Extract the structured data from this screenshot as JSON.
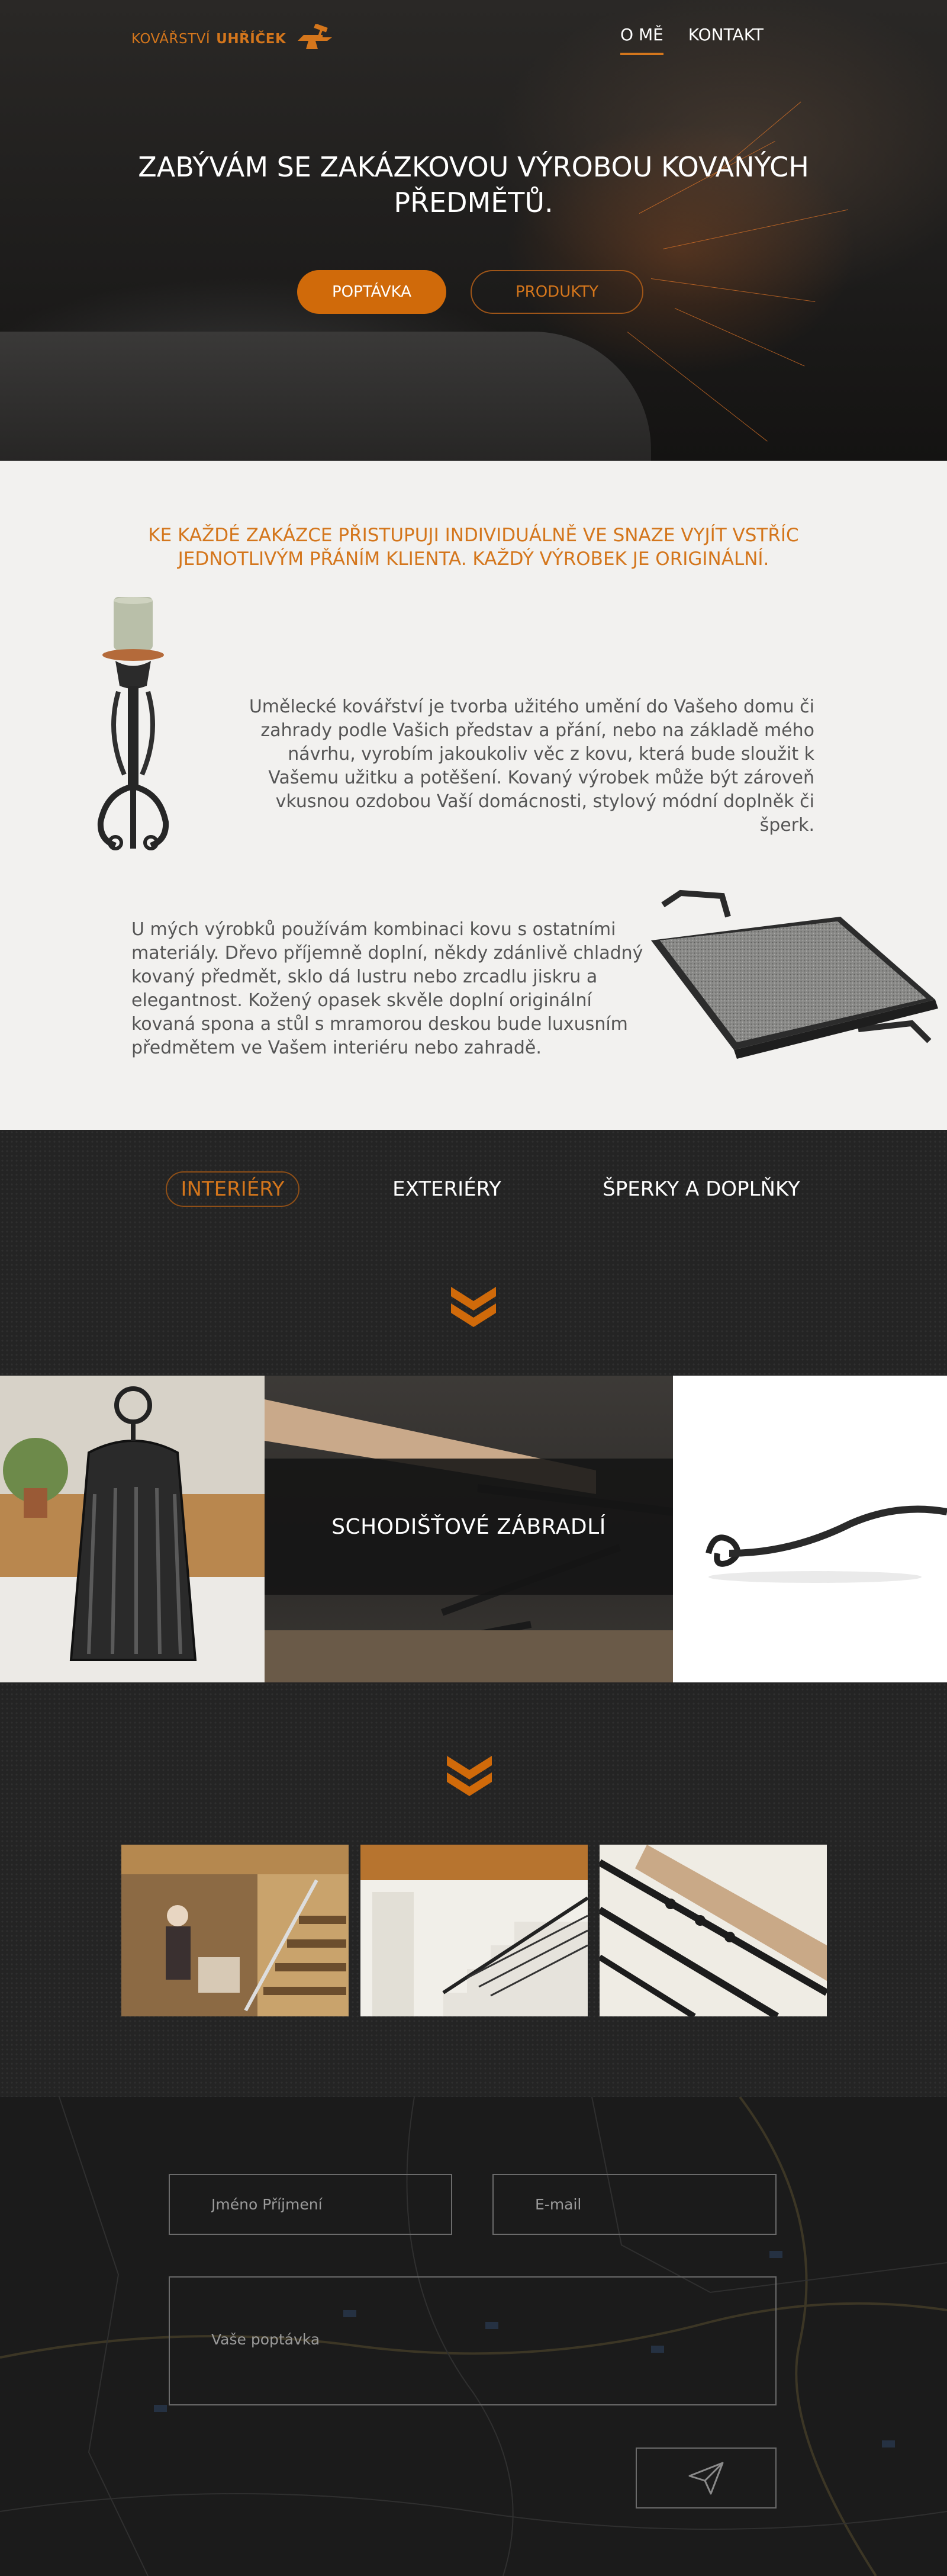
{
  "header": {
    "logo_text": "KOVÁŘSTVÍ",
    "logo_strong": "UHŘÍČEK",
    "nav": [
      {
        "label": "O MĚ",
        "active": true
      },
      {
        "label": "KONTAKT",
        "active": false
      }
    ]
  },
  "hero": {
    "title": "ZABÝVÁM SE ZAKÁZKOVOU VÝROBOU KOVANÝCH PŘEDMĚTŮ.",
    "btn_primary": "POPTÁVKA",
    "btn_secondary": "PRODUKTY"
  },
  "about": {
    "lead": "KE KAŽDÉ ZAKÁZCE PŘISTUPUJI INDIVIDUÁLNĚ VE SNAZE VYJÍT VSTŘÍC JEDNOTLIVÝM PŘÁNÍM KLIENTA. KAŽDÝ VÝROBEK JE ORIGINÁLNÍ.",
    "paragraph1": "Umělecké kovářství je tvorba užitého umění do Vašeho domu či zahrady podle Vašich představ a přání, nebo na základě mého návrhu, vyrobím jakoukoliv věc z kovu, která bude sloužit k Vašemu užitku a potěšení. Kovaný výrobek může být zároveň vkusnou ozdobou Vaší domácnosti, stylový módní doplněk či šperk.",
    "paragraph2": "U mých výrobků používám kombinaci kovu s ostatními materiály. Dřevo příjemně doplní, někdy zdánlivě chladný kovaný předmět, sklo dá lustru nebo zrcadlu jiskru a elegantnost. Kožený opasek skvěle doplní originální kovaná spona a stůl s mramorou deskou bude luxusním předmětem ve Vašem interiéru nebo zahradě."
  },
  "categories": {
    "tabs": [
      {
        "label": "INTERIÉRY",
        "active": true
      },
      {
        "label": "EXTERIÉRY",
        "active": false
      },
      {
        "label": "ŠPERKY A DOPLŇKY",
        "active": false
      }
    ]
  },
  "gallery": {
    "featured_caption": "SCHODIŠŤOVÉ ZÁBRADLÍ"
  },
  "contact": {
    "name_placeholder": "Jméno Příjmení",
    "email_placeholder": "E-mail",
    "message_placeholder": "Vaše poptávka"
  },
  "colors": {
    "accent": "#d4761c",
    "dark_bg": "#242424",
    "light_bg": "#f2f1ef"
  },
  "icons": {
    "logo": "anvil-hammer-icon",
    "section_marker": "chevron-down-double-icon",
    "send": "paper-plane-icon"
  }
}
